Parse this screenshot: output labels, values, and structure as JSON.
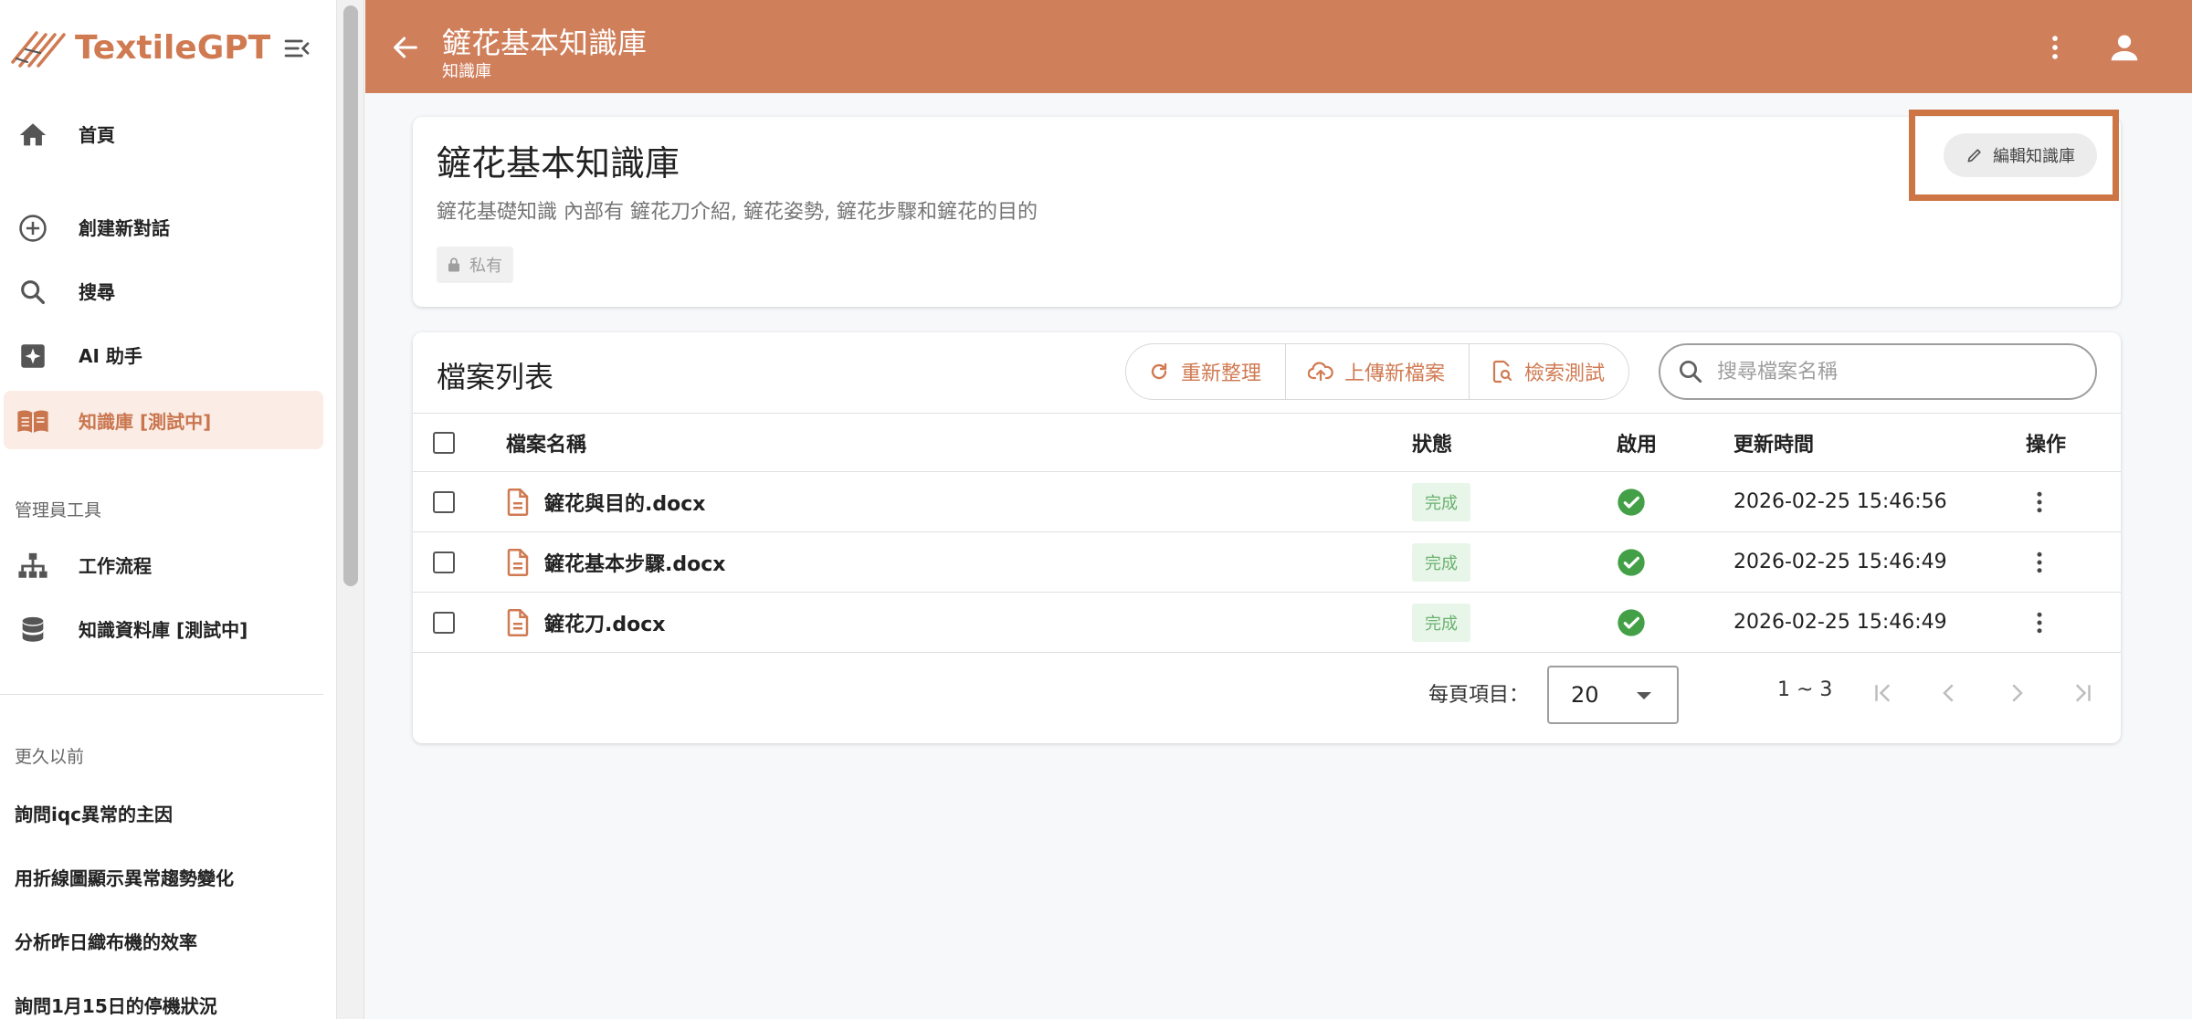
{
  "app": {
    "name": "TextileGPT",
    "brand_color": "#d07a52"
  },
  "sidebar": {
    "items": [
      {
        "label": "首頁",
        "icon": "home-icon"
      },
      {
        "label": "創建新對話",
        "icon": "add-circle-icon"
      },
      {
        "label": "搜尋",
        "icon": "search-icon"
      },
      {
        "label": "AI 助手",
        "icon": "sparkle-icon"
      },
      {
        "label": "知識庫 [測試中]",
        "icon": "book-icon",
        "active": true
      }
    ],
    "admin_section": "管理員工具",
    "admin_items": [
      {
        "label": "工作流程",
        "icon": "sitemap-icon"
      },
      {
        "label": "知識資料庫 [測試中]",
        "icon": "database-icon"
      }
    ],
    "history_section": "更久以前",
    "history": [
      "詢問iqc異常的主因",
      "用折線圖顯示異常趨勢變化",
      "分析昨日織布機的效率",
      "詢問1月15日的停機狀況"
    ]
  },
  "header": {
    "title": "鏟花基本知識庫",
    "subtitle": "知識庫"
  },
  "kb": {
    "title": "鏟花基本知識庫",
    "description": "鏟花基礎知識 內部有 鏟花刀介紹, 鏟花姿勢, 鏟花步驟和鏟花的目的",
    "visibility": "私有",
    "edit_label": "編輯知識庫"
  },
  "files": {
    "title": "檔案列表",
    "actions": {
      "refresh": "重新整理",
      "upload": "上傳新檔案",
      "test": "檢索測試"
    },
    "search_placeholder": "搜尋檔案名稱",
    "columns": {
      "name": "檔案名稱",
      "status": "狀態",
      "enabled": "啟用",
      "updated": "更新時間",
      "ops": "操作"
    },
    "rows": [
      {
        "name": "鏟花與目的.docx",
        "status": "完成",
        "enabled": true,
        "updated": "2026-02-25 15:46:56"
      },
      {
        "name": "鏟花基本步驟.docx",
        "status": "完成",
        "enabled": true,
        "updated": "2026-02-25 15:46:49"
      },
      {
        "name": "鏟花刀.docx",
        "status": "完成",
        "enabled": true,
        "updated": "2026-02-25 15:46:49"
      }
    ],
    "pagination": {
      "per_page_label": "每頁項目：",
      "per_page": "20",
      "range": "1 ~ 3"
    }
  },
  "colors": {
    "header": "#d07f5b",
    "accent": "#d07a52",
    "success": "#43a047",
    "highlight": "#cd7545"
  }
}
